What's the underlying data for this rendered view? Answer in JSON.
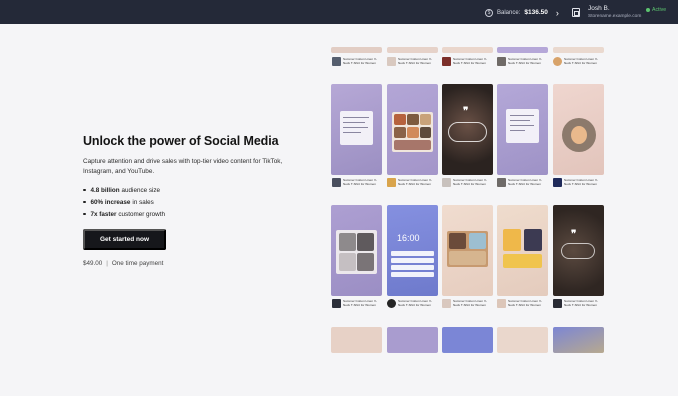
{
  "topbar": {
    "balance_label": "Balance:",
    "balance_amount": "$136.50",
    "user_name": "Josh B.",
    "user_email": "Storename.example.com",
    "status": "Active"
  },
  "hero": {
    "headline": "Unlock the power of Social Media",
    "subtitle": "Capture attention and drive sales with top-tier video content for TikTok, Instagram, and YouTube.",
    "features": [
      {
        "bold": "4.8 billion",
        "rest": "audience size"
      },
      {
        "bold": "60% increase",
        "rest": "in sales"
      },
      {
        "bold": "7x faster",
        "rest": "customer growth"
      }
    ],
    "cta": "Get started now",
    "price": "$49.00",
    "price_note": "One time payment"
  },
  "grid": {
    "caption": "Summer Cotton Linen V-Neck T-Shirt for Women"
  },
  "colors": {
    "topbar": "#242938",
    "accent_green": "#5cc46f",
    "cta": "#16171b",
    "lavender": "#a9a0cc",
    "periwinkle": "#7b86d6",
    "peach": "#e8cfc4",
    "dark": "#3a302c"
  }
}
